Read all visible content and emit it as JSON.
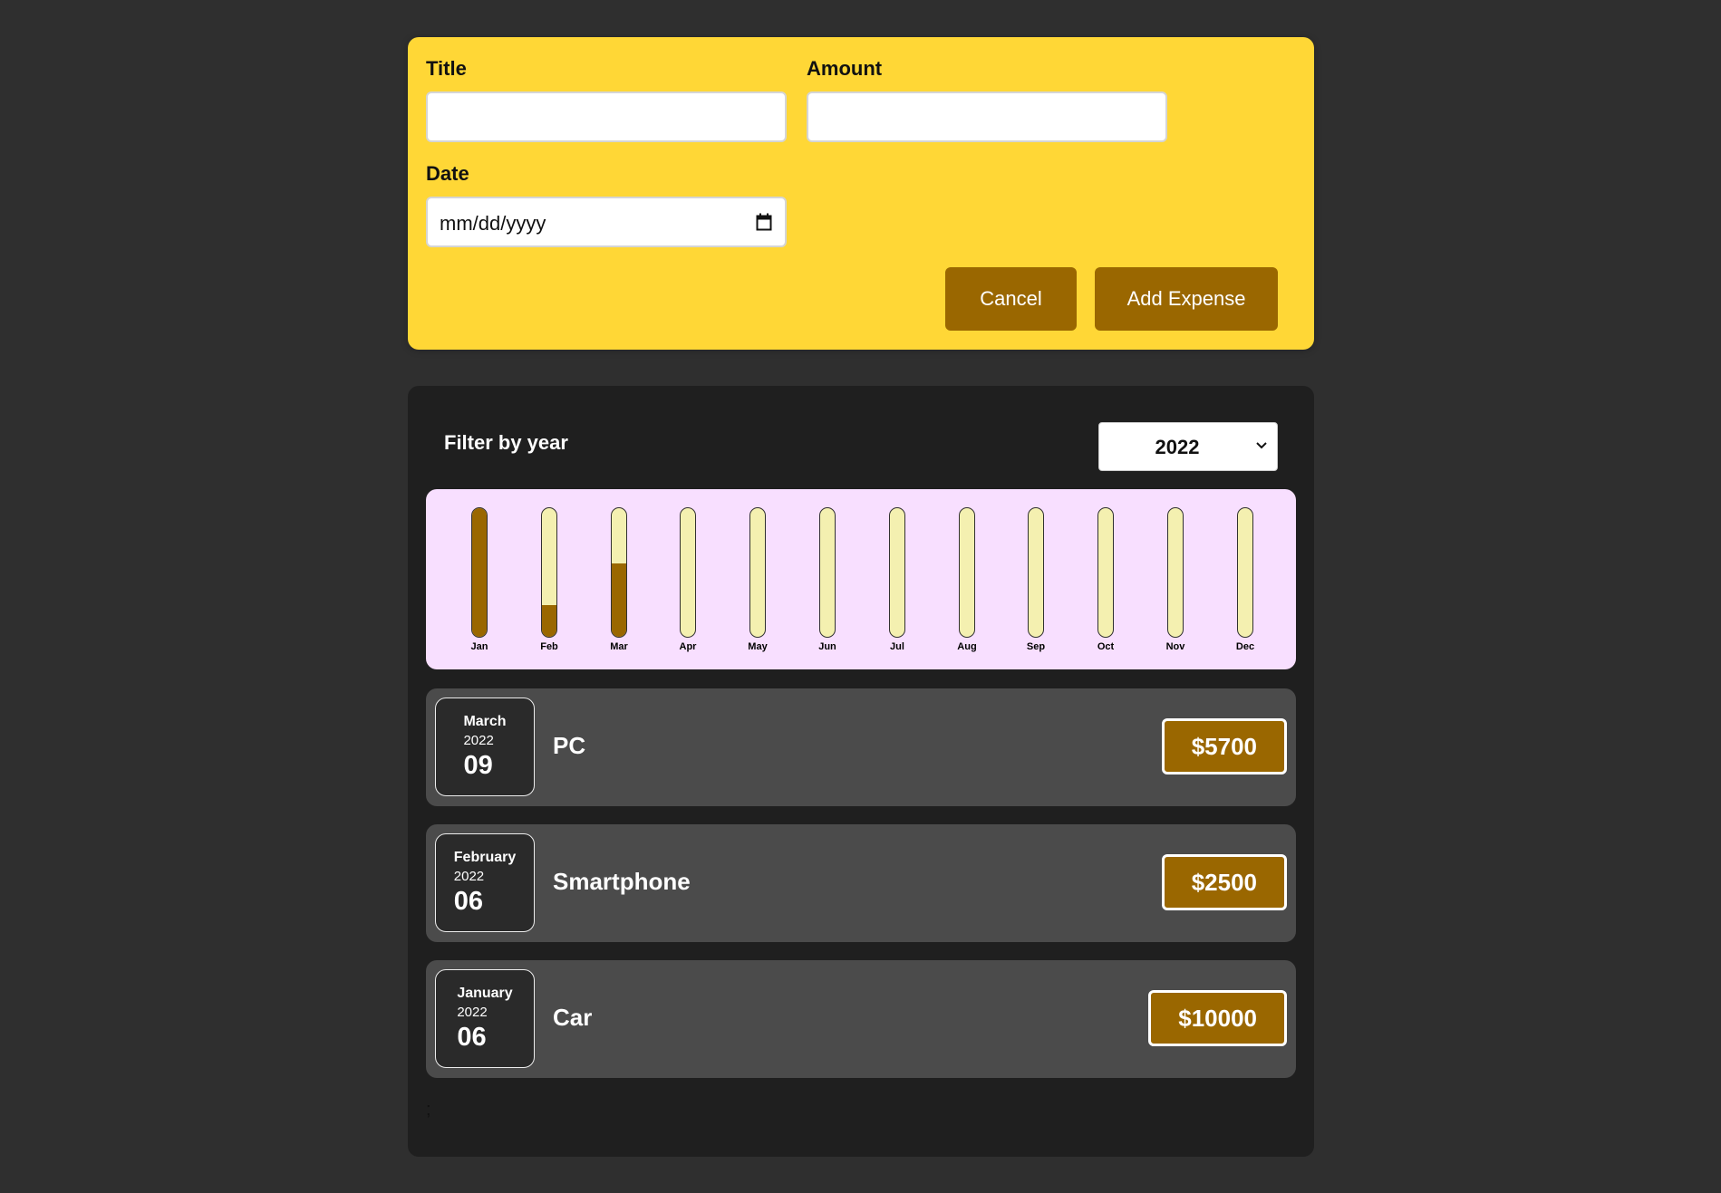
{
  "form": {
    "title_label": "Title",
    "title_value": "",
    "amount_label": "Amount",
    "amount_value": "",
    "date_label": "Date",
    "date_placeholder": "mm/dd/yyyy",
    "cancel_label": "Cancel",
    "add_label": "Add Expense",
    "colors": {
      "background": "#ffd736",
      "button": "#9a6700"
    }
  },
  "filter": {
    "label": "Filter by year",
    "selected_year": "2022"
  },
  "chart": {
    "bars": [
      {
        "label": "Jan",
        "fill": 1.0
      },
      {
        "label": "Feb",
        "fill": 0.25
      },
      {
        "label": "Mar",
        "fill": 0.57
      },
      {
        "label": "Apr",
        "fill": 0
      },
      {
        "label": "May",
        "fill": 0
      },
      {
        "label": "Jun",
        "fill": 0
      },
      {
        "label": "Jul",
        "fill": 0
      },
      {
        "label": "Aug",
        "fill": 0
      },
      {
        "label": "Sep",
        "fill": 0
      },
      {
        "label": "Oct",
        "fill": 0
      },
      {
        "label": "Nov",
        "fill": 0
      },
      {
        "label": "Dec",
        "fill": 0
      }
    ],
    "colors": {
      "background": "#f8dfff",
      "fill": "#9a6700",
      "track": "#f4f0b0"
    }
  },
  "expenses": [
    {
      "month": "March",
      "year": "2022",
      "day": "09",
      "title": "PC",
      "amount": "$5700"
    },
    {
      "month": "February",
      "year": "2022",
      "day": "06",
      "title": "Smartphone",
      "amount": "$2500"
    },
    {
      "month": "January",
      "year": "2022",
      "day": "06",
      "title": "Car",
      "amount": "$10000"
    }
  ],
  "stray_text": ";",
  "icons": {
    "calendar": "calendar-icon",
    "select": "chevron-down-icon"
  }
}
